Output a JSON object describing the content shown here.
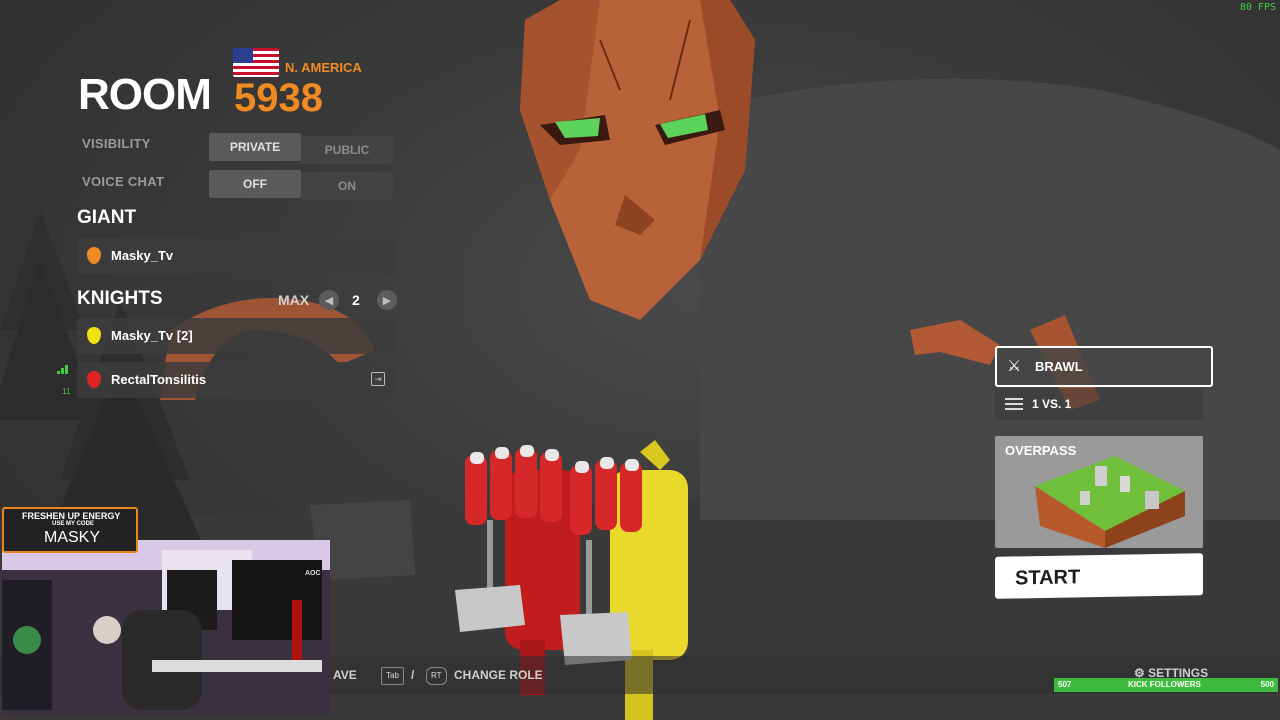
{
  "hud": {
    "fps": "80 FPS"
  },
  "room": {
    "title": "ROOM",
    "code": "5938",
    "region": "N. AMERICA"
  },
  "options": {
    "visibility": {
      "label": "VISIBILITY",
      "choices": [
        "PRIVATE",
        "PUBLIC"
      ],
      "selected": "PRIVATE"
    },
    "voice_chat": {
      "label": "VOICE CHAT",
      "choices": [
        "OFF",
        "ON"
      ],
      "selected": "OFF"
    }
  },
  "giant": {
    "title": "GIANT",
    "players": [
      {
        "name": "Masky_Tv",
        "color": "#f08a22"
      }
    ]
  },
  "knights": {
    "title": "KNIGHTS",
    "max_label": "MAX",
    "max_value": "2",
    "players": [
      {
        "name": "Masky_Tv [2]",
        "color": "#f2e010"
      },
      {
        "name": "RectalTonsilitis",
        "color": "#e02424",
        "ping": "11"
      }
    ]
  },
  "match": {
    "mode": "BRAWL",
    "teams": "1 VS. 1",
    "map": "OVERPASS",
    "start_label": "START"
  },
  "bottom_bar": {
    "leave_label": "AVE",
    "tab_key": "Tab",
    "separator": "/",
    "rt_key": "RT",
    "change_role_label": "CHANGE ROLE",
    "settings_label": "SETTINGS"
  },
  "stream_overlay": {
    "promo_line1": "FRESHEN UP ENERGY",
    "promo_line2": "USE MY CODE",
    "promo_code": "MASKY",
    "followers_current": "507",
    "followers_label": "KICK FOLLOWERS",
    "followers_goal": "500",
    "monitor_brand": "AOC"
  },
  "colors": {
    "accent": "#f08a22",
    "giant_red": "#e02424",
    "knight_yellow": "#f2e010",
    "signal_green": "#3ecf3e"
  }
}
